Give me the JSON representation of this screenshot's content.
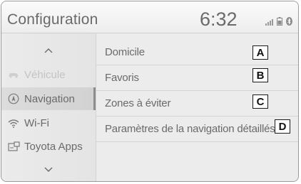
{
  "header": {
    "title": "Configuration",
    "clock": "6:32",
    "status_icons": [
      "signal-icon",
      "battery-icon",
      "bluetooth-icon"
    ]
  },
  "sidebar": {
    "items": [
      {
        "label": "Véhicule",
        "icon": "car-icon",
        "state": "disabled"
      },
      {
        "label": "Navigation",
        "icon": "navigation-icon",
        "state": "selected"
      },
      {
        "label": "Wi-Fi",
        "icon": "wifi-icon",
        "state": "normal"
      },
      {
        "label": "Toyota Apps",
        "icon": "apps-icon",
        "state": "normal"
      }
    ]
  },
  "menu": {
    "items": [
      {
        "label": "Domicile",
        "callout": "A"
      },
      {
        "label": "Favoris",
        "callout": "B"
      },
      {
        "label": "Zones à éviter",
        "callout": "C"
      },
      {
        "label": "Paramètres de la navigation détaillés",
        "callout": "D"
      }
    ]
  },
  "colors": {
    "text": "#6a6a6a",
    "disabled_text": "#c4c4c4",
    "background": "#ececec",
    "callout_border": "#1a1a1a"
  }
}
